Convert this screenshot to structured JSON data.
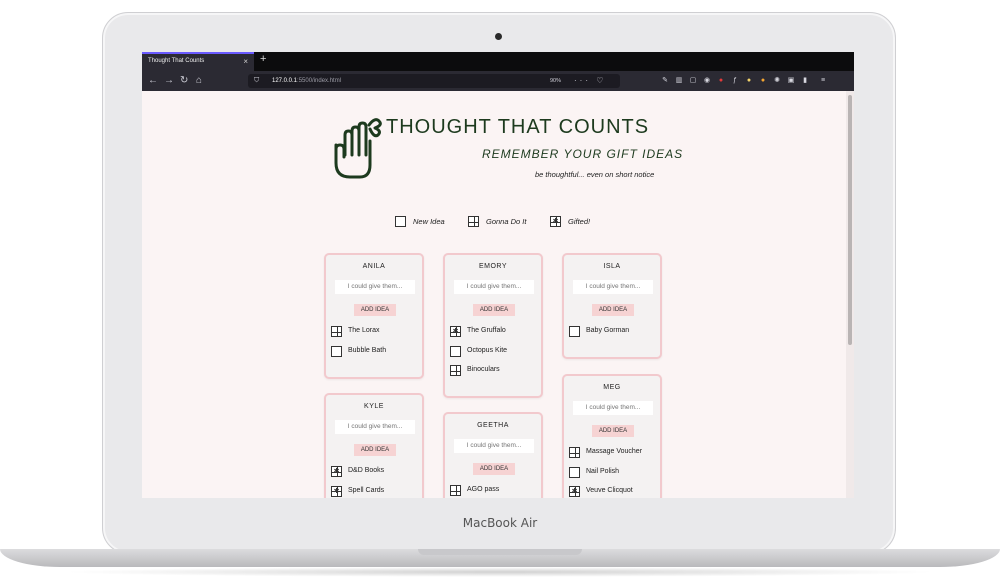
{
  "device": {
    "label": "MacBook Air"
  },
  "browser": {
    "tab_title": "Thought That Counts",
    "tab_close": "×",
    "new_tab": "+",
    "url_host": "127.0.0.1",
    "url_rest": ":5500/index.html",
    "zoom": "90%",
    "url_actions": "··· ♡ ☆",
    "nav": {
      "back": "←",
      "forward": "→",
      "reload": "↻",
      "home": "⌂"
    }
  },
  "app": {
    "title": "THOUGHT THAT COUNTS",
    "subtitle": "REMEMBER YOUR GIFT IDEAS",
    "tagline": "be thoughtful... even on short notice"
  },
  "legend": [
    {
      "status": "new",
      "label": "New Idea"
    },
    {
      "status": "planned",
      "label": "Gonna Do It"
    },
    {
      "status": "gifted",
      "label": "Gifted!"
    }
  ],
  "input_placeholder": "I could give them...",
  "add_button_label": "ADD IDEA",
  "people": [
    {
      "name": "ANILA",
      "ideas": [
        {
          "text": "The Lorax",
          "status": "planned"
        },
        {
          "text": "Bubble Bath",
          "status": "new"
        }
      ]
    },
    {
      "name": "EMORY",
      "ideas": [
        {
          "text": "The Gruffalo",
          "status": "gifted"
        },
        {
          "text": "Octopus Kite",
          "status": "new"
        },
        {
          "text": "Binoculars",
          "status": "planned"
        }
      ]
    },
    {
      "name": "ISLA",
      "ideas": [
        {
          "text": "Baby Gorman",
          "status": "new"
        }
      ]
    },
    {
      "name": "KYLE",
      "ideas": [
        {
          "text": "D&D Books",
          "status": "gifted"
        },
        {
          "text": "Spell Cards",
          "status": "gifted"
        }
      ]
    },
    {
      "name": "GEETHA",
      "ideas": [
        {
          "text": "AGO pass",
          "status": "planned"
        }
      ]
    },
    {
      "name": "MEG",
      "ideas": [
        {
          "text": "Massage Voucher",
          "status": "planned"
        },
        {
          "text": "Nail Polish",
          "status": "new"
        },
        {
          "text": "Veuve Clicquot",
          "status": "gifted"
        }
      ]
    }
  ],
  "colors": {
    "page_bg": "#fbf4f4",
    "card_border": "#f2c9cd",
    "button_bg": "#f6d3d3",
    "brand_green": "#1d3a1e"
  }
}
